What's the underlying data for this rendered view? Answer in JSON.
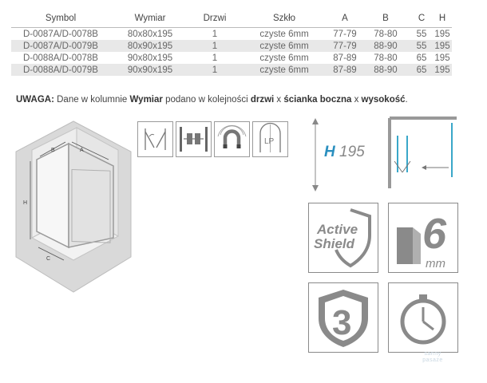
{
  "table": {
    "headers": [
      "Symbol",
      "Wymiar",
      "Drzwi",
      "Szkło",
      "A",
      "B",
      "C",
      "H"
    ],
    "rows": [
      [
        "D-0087A/D-0078B",
        "80x80x195",
        "1",
        "czyste 6mm",
        "77-79",
        "78-80",
        "55",
        "195"
      ],
      [
        "D-0087A/D-0079B",
        "80x90x195",
        "1",
        "czyste 6mm",
        "77-79",
        "88-90",
        "55",
        "195"
      ],
      [
        "D-0088A/D-0078B",
        "90x80x195",
        "1",
        "czyste 6mm",
        "87-89",
        "78-80",
        "65",
        "195"
      ],
      [
        "D-0088A/D-0079B",
        "90x90x195",
        "1",
        "czyste 6mm",
        "87-89",
        "88-90",
        "65",
        "195"
      ]
    ]
  },
  "note": {
    "label": "UWAGA:",
    "text1": " Dane w kolumnie ",
    "bold1": "Wymiar",
    "text2": " podano w kolejności ",
    "bold2": "drzwi",
    "text3": " x ",
    "bold3": "ścianka boczna",
    "text4": " x ",
    "bold4": "wysokość",
    "text5": "."
  },
  "diagram": {
    "label_a": "A",
    "label_b": "B",
    "label_h": "H",
    "label_c": "C"
  },
  "height": {
    "prefix": "H",
    "value": "195"
  },
  "icons": {
    "hinge": "hinge-door-icon",
    "handle": "handle-icon",
    "magnet": "magnet-icon",
    "lp": "left-right-icon",
    "lp_text": "LP"
  },
  "badges": {
    "active_shield_line1": "Active",
    "active_shield_line2": "Shield",
    "glass_thickness": "6",
    "glass_unit": "mm",
    "warranty_years": "3"
  },
  "watermark": "sanny\npasaże",
  "colors": {
    "accent": "#2a8fbf",
    "door_line": "#3aa7c9",
    "badge_gray": "#8a8a8a",
    "row_shade": "#e8e8e8"
  }
}
